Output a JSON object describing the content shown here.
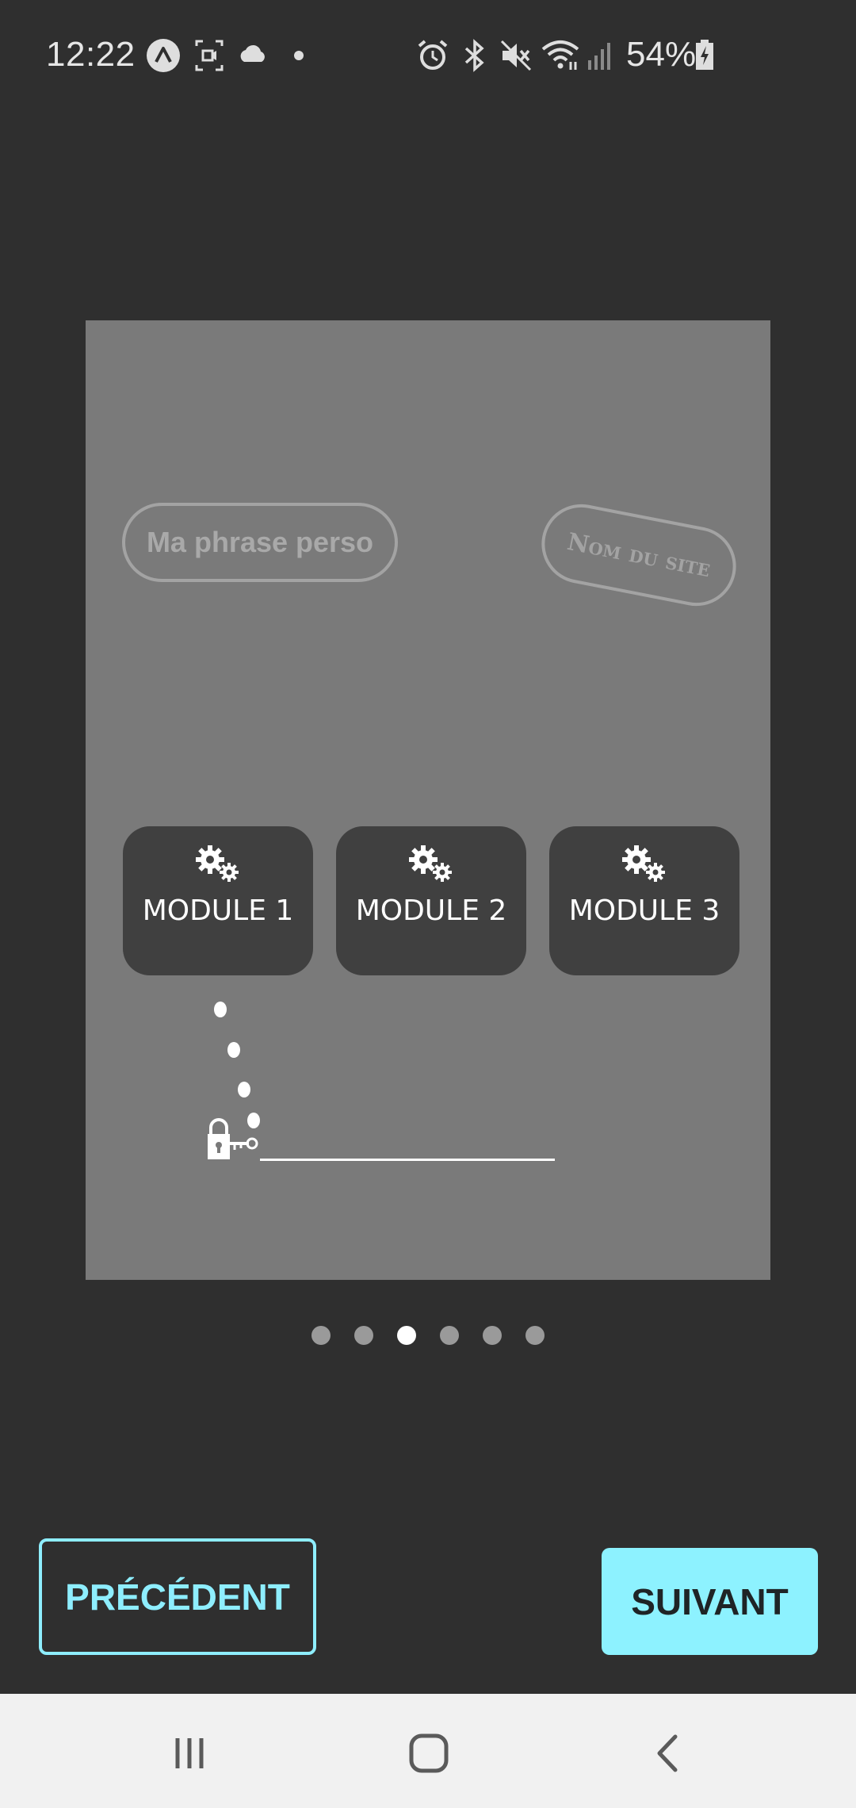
{
  "status_bar": {
    "time": "12:22",
    "battery": "54%",
    "icons": [
      "app-a-icon",
      "screen-record-icon",
      "cloud-icon",
      "dot-icon",
      "alarm-icon",
      "bluetooth-icon",
      "mute-icon",
      "wifi-icon",
      "signal-icon",
      "battery-charging-icon"
    ]
  },
  "preview": {
    "phrase": "Ma phrase perso",
    "site_name": "Nom du site",
    "modules": [
      {
        "label": "MODULE 1",
        "icon": "gears-icon"
      },
      {
        "label": "MODULE 2",
        "icon": "gears-icon"
      },
      {
        "label": "MODULE 3",
        "icon": "gears-icon"
      }
    ]
  },
  "pager": {
    "count": 6,
    "active_index": 2
  },
  "buttons": {
    "previous": "PRÉCÉDENT",
    "next": "SUIVANT"
  },
  "colors": {
    "accent": "#8eeeff",
    "background": "#2f2f2f",
    "preview_bg": "#7a7a7a",
    "module_bg": "#404040"
  },
  "nav_bar": {
    "icons": [
      "recent-apps-icon",
      "home-icon",
      "back-icon"
    ]
  }
}
